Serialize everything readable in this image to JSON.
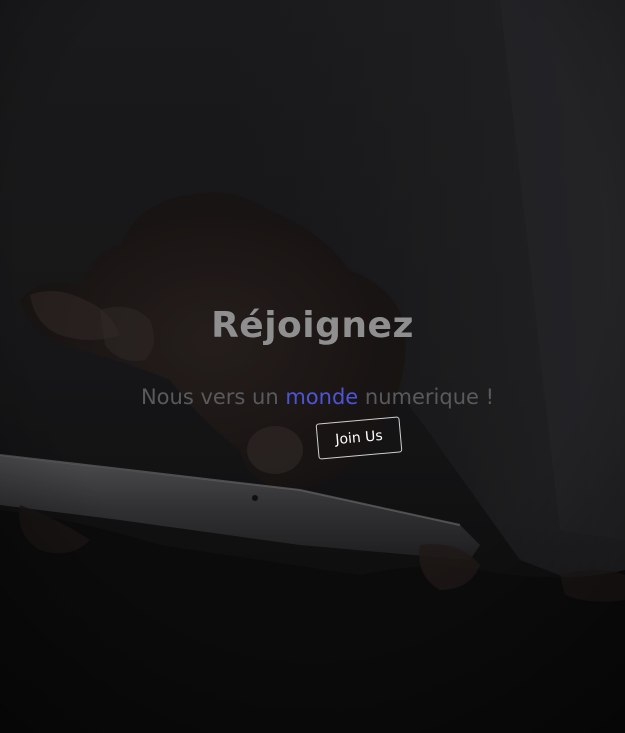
{
  "hero": {
    "background_image": "photo-hands-holding-tablet",
    "title": "Réjoignez",
    "subtitle_before": "Nous vers un ",
    "subtitle_highlight": "monde",
    "subtitle_after": " numerique !",
    "button_label": "Join Us"
  },
  "colors": {
    "title": "#8f8f8f",
    "subtitle": "#5a5a5c",
    "highlight": "#4d55d6",
    "button_border": "#cfcfcf",
    "button_text": "#ffffff",
    "background": "#1a1a1c"
  }
}
